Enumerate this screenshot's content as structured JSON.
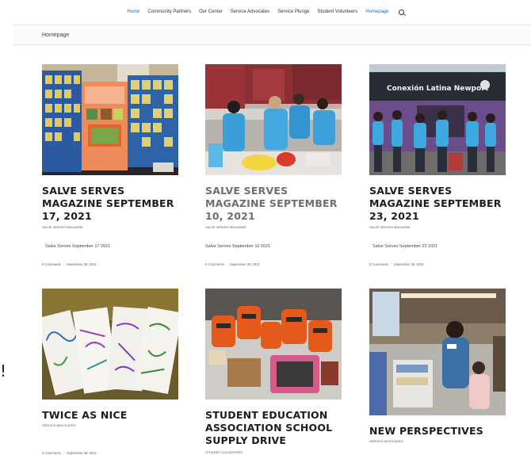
{
  "nav": {
    "items": [
      "Home",
      "Community Partners",
      "Our Center",
      "Service Advocates",
      "Service Plunge",
      "Student Volunteers",
      "Homepage"
    ],
    "search_icon": "search-icon"
  },
  "breadcrumb": "Homepage",
  "posts": [
    {
      "title": "SALVE SERVES MAGAZINE SEPTEMBER 17, 2021",
      "category": "SALVE SERVES MAGAZINE",
      "excerpt": "Salve Serves September 17 2021",
      "comments": "0 Comments",
      "date": "September 28, 2021",
      "image": "trifold-poster-board"
    },
    {
      "title": "SALVE SERVES MAGAZINE SEPTEMBER 10, 2021",
      "category": "SALVE SERVES MAGAZINE",
      "excerpt": "Salve Serves September 10 2021",
      "comments": "0 Comments",
      "date": "September 28, 2021",
      "image": "volunteers-in-kitchen"
    },
    {
      "title": "SALVE SERVES MAGAZINE SEPTEMBER 23, 2021",
      "category": "SALVE SERVES MAGAZINE",
      "excerpt": "Salve Serves September 23 2021",
      "comments": "0 Comments",
      "date": "September 28, 2021",
      "image": "volunteers-outside-center",
      "sign_text": "Conexión Latina Newport"
    },
    {
      "title": "TWICE AS NICE",
      "category": "SERVICE ADVOCATES",
      "comments": "0 Comments",
      "date": "September 28, 2021",
      "image": "handmade-thank-you-cards"
    },
    {
      "title": "STUDENT EDUCATION ASSOCIATION SCHOOL SUPPLY DRIVE",
      "category": "STUDENT VOLUNTEERS",
      "image": "backpacks-and-supplies"
    },
    {
      "title": "NEW PERSPECTIVES",
      "category": "SERVICE ADVOCATES",
      "image": "volunteer-serving-child"
    }
  ],
  "colors": {
    "nav_active": "#1a6fc0",
    "title": "#1d1d1d",
    "title_faded": "#6b6f74"
  }
}
